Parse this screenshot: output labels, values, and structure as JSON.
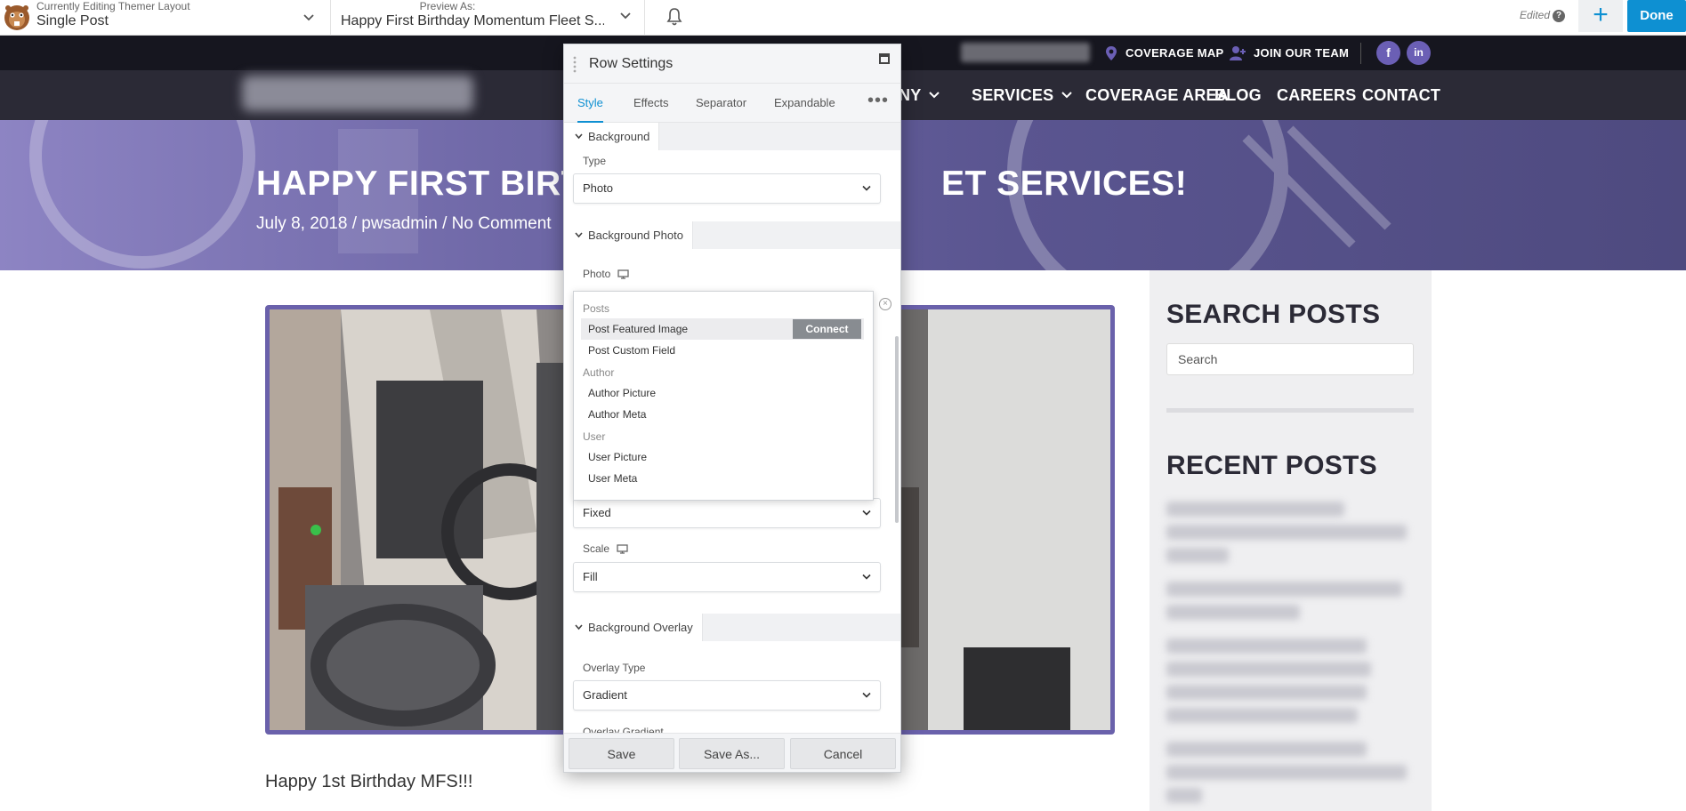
{
  "topbar": {
    "editing_caption": "Currently Editing Themer Layout",
    "editing_value": "Single Post",
    "preview_caption": "Preview As:",
    "preview_value": "Happy First Birthday Momentum Fleet S...",
    "edited_label": "Edited",
    "help_glyph": "?",
    "plus_glyph": "+",
    "done_label": "Done"
  },
  "utility": {
    "coverage_map": "COVERAGE MAP",
    "join_team": "JOIN OUR TEAM",
    "facebook": "f",
    "linkedin": "in"
  },
  "nav": {
    "partial": "NY",
    "services": "SERVICES",
    "coverage_area": "COVERAGE AREA",
    "blog": "BLOG",
    "careers": "CAREERS",
    "contact": "CONTACT"
  },
  "hero": {
    "title_left": "HAPPY FIRST BIRTH",
    "title_right": "ET SERVICES!",
    "meta": "July 8, 2018  /  pwsadmin  /  No Comment"
  },
  "content": {
    "post_text": "Happy 1st Birthday MFS!!!"
  },
  "sidebar": {
    "search_heading": "SEARCH POSTS",
    "search_placeholder": "Search",
    "recent_heading": "RECENT POSTS"
  },
  "panel": {
    "title": "Row Settings",
    "tabs": [
      "Style",
      "Effects",
      "Separator",
      "Expandable"
    ],
    "more": "•••",
    "sections": {
      "background": "Background",
      "background_photo": "Background Photo",
      "background_overlay": "Background Overlay"
    },
    "fields": {
      "type_label": "Type",
      "type_value": "Photo",
      "photo_label": "Photo",
      "attachment_value": "Fixed",
      "scale_label": "Scale",
      "scale_value": "Fill",
      "overlay_type_label": "Overlay Type",
      "overlay_type_value": "Gradient",
      "overlay_gradient_label": "Overlay Gradient"
    },
    "dropdown": {
      "groups": [
        "Posts",
        "Author",
        "User"
      ],
      "items": [
        "Post Featured Image",
        "Post Custom Field",
        "Author Picture",
        "Author Meta",
        "User Picture",
        "User Meta"
      ],
      "connect": "Connect",
      "close": "×"
    },
    "footer": {
      "save": "Save",
      "save_as": "Save As...",
      "cancel": "Cancel"
    }
  },
  "colors": {
    "accent": "#0e90d2",
    "brand_purple": "#6b5fb5",
    "nav_dark": "#2b2a36"
  }
}
